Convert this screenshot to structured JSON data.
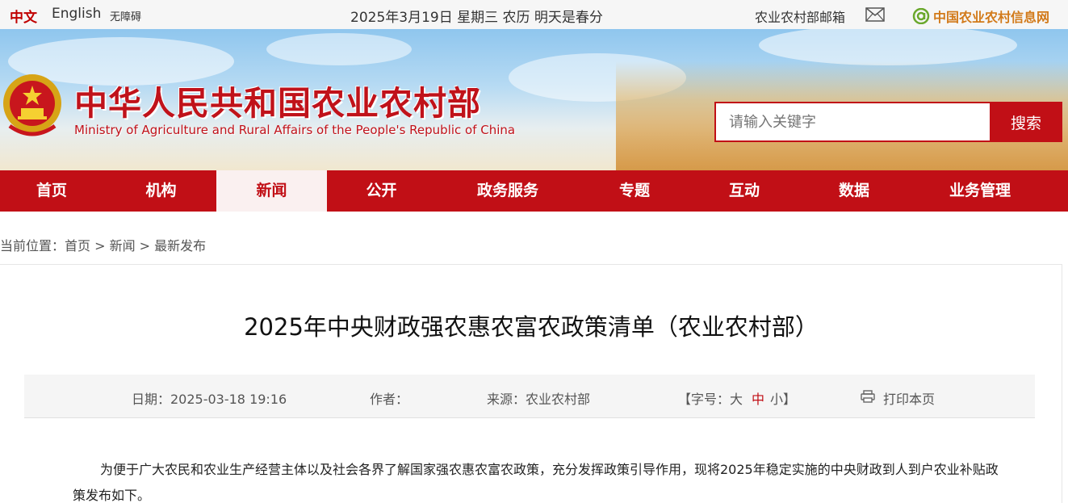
{
  "topbar": {
    "lang_cn": "中文",
    "lang_en": "English",
    "accessibility": "无障碍",
    "date": "2025年3月19日 星期三 农历 明天是春分",
    "mail": "农业农村部邮箱",
    "mail_icon": "mail-icon",
    "site_link": "中国农业农村信息网",
    "site_icon": "at-sign-icon"
  },
  "banner": {
    "title_cn": "中华人民共和国农业农村部",
    "title_en": "Ministry of Agriculture and Rural Affairs of the People's Republic of China",
    "emblem_icon": "national-emblem-icon"
  },
  "search": {
    "placeholder": "请输入关键字",
    "button": "搜索"
  },
  "nav": {
    "items": [
      {
        "label": "首页"
      },
      {
        "label": "机构"
      },
      {
        "label": "新闻"
      },
      {
        "label": "公开"
      },
      {
        "label": "政务服务"
      },
      {
        "label": "专题"
      },
      {
        "label": "互动"
      },
      {
        "label": "数据"
      },
      {
        "label": "业务管理"
      }
    ],
    "active": "新闻"
  },
  "breadcrumb": "当前位置：首页 > 新闻 > 最新发布",
  "article": {
    "title": "2025年中央财政强农惠农富农政策清单（农业农村部）",
    "date": "日期：2025-03-18 19:16",
    "author": "作者：",
    "source": "来源：农业农村部",
    "fontsize_prefix": "【字号：大",
    "fontsize_mid": "中",
    "fontsize_suffix": "小】",
    "print": "打印本页",
    "print_icon": "printer-icon",
    "paragraph": "为便于广大农民和农业生产经营主体以及社会各界了解国家强农惠农富农政策，充分发挥政策引导作用，现将2025年稳定实施的中央财政到人到户农业补贴政策发布如下。"
  },
  "colors": {
    "brand_red": "#c10f16",
    "site_link_orange": "#d27a1a"
  }
}
